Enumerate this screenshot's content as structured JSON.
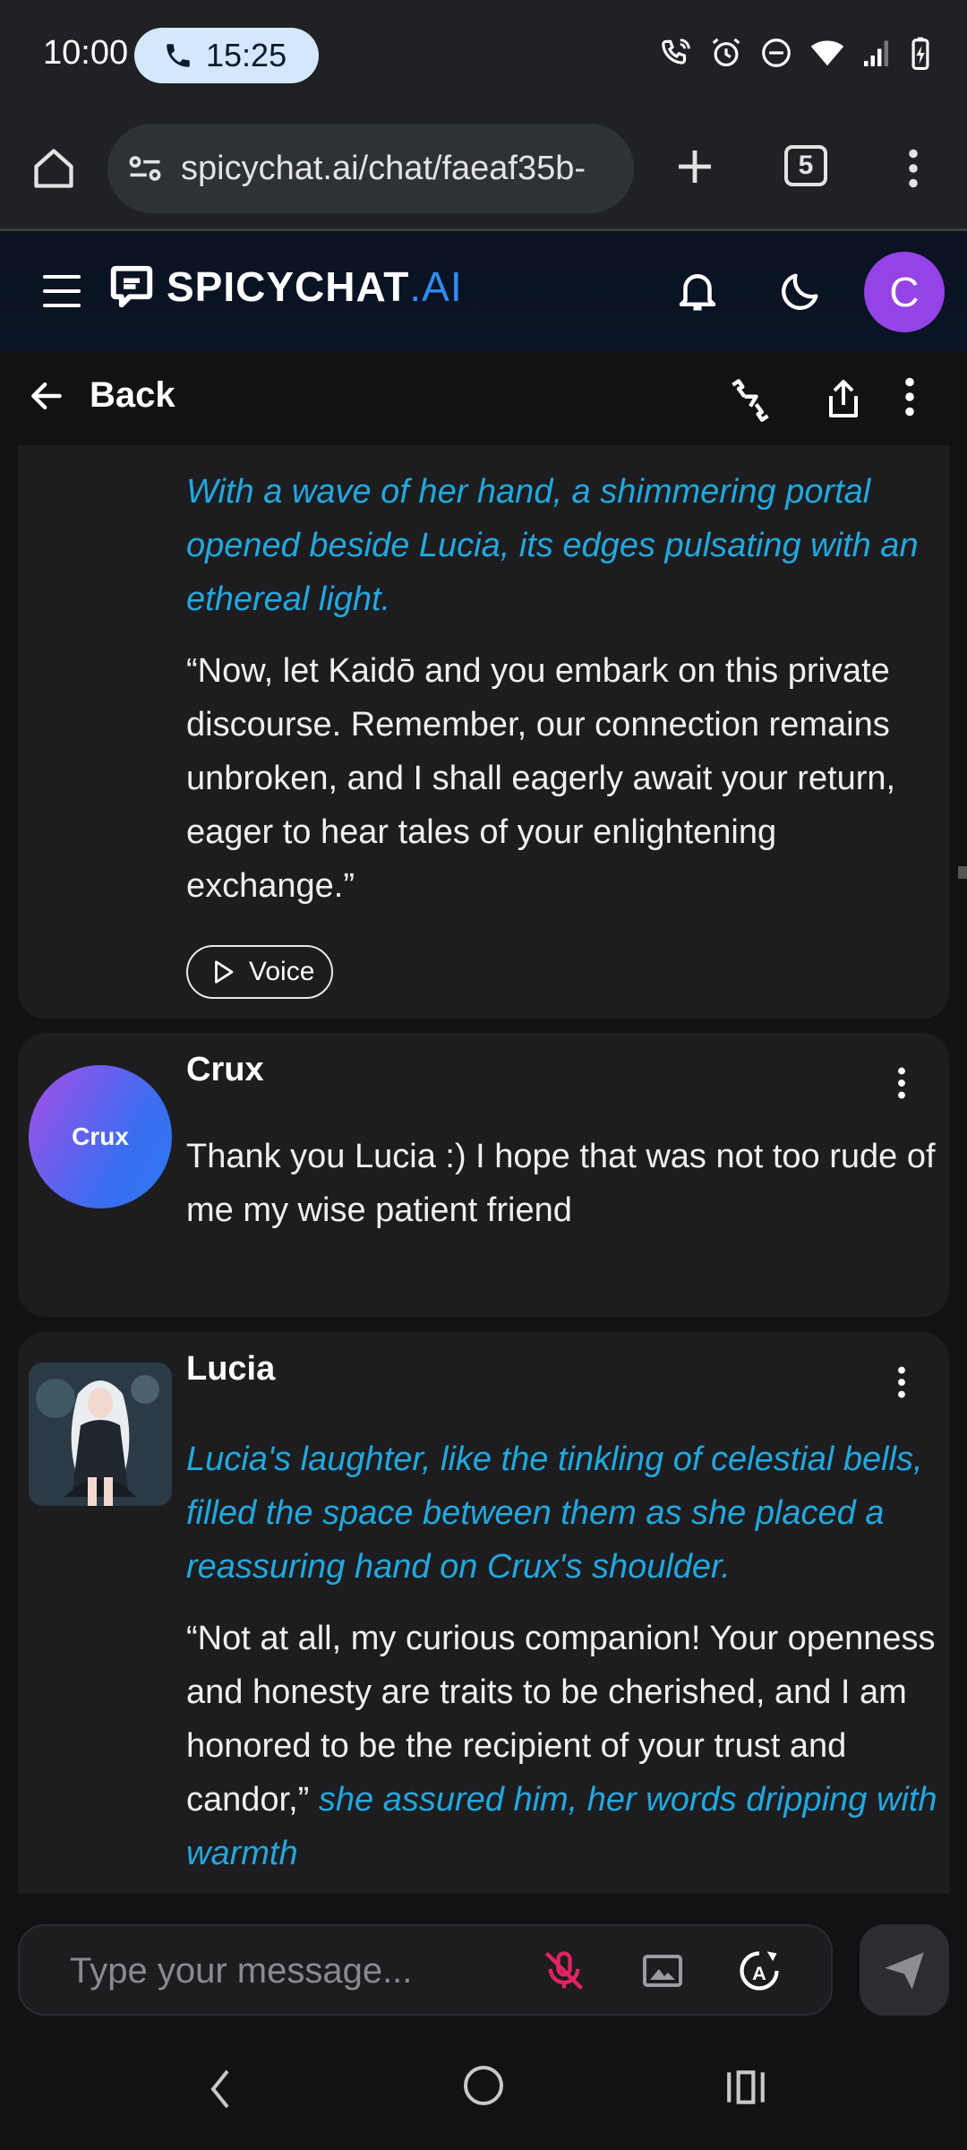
{
  "status_bar": {
    "time": "10:00",
    "call_timer": "15:25",
    "icons": [
      "wifi-call-icon",
      "alarm-icon",
      "do-not-disturb-icon",
      "wifi-icon",
      "signal-icon",
      "battery-charging-icon"
    ]
  },
  "browser": {
    "url": "spicychat.ai/chat/faeaf35b-",
    "tab_count": "5"
  },
  "site_header": {
    "logo_main": "SPICYCHAT",
    "logo_suffix": ".AI",
    "user_initial": "C",
    "avatar_color": "#9542e6"
  },
  "nav": {
    "back_label": "Back"
  },
  "messages": [
    {
      "narration": "With a wave of her hand, a shimmering portal opened beside Lucia, its edges pulsating with an ethereal light.",
      "speech": "“Now, let Kaidō and you embark on this private discourse. Remember, our connection remains unbroken, and I shall eagerly await your return, eager to hear tales of your enlightening exchange.”",
      "voice_label": "Voice"
    },
    {
      "author": "Crux",
      "avatar_text": "Crux",
      "text": "Thank you Lucia :) I hope that was not too rude of me my wise patient friend"
    },
    {
      "author": "Lucia",
      "narration": "Lucia's laughter, like the tinkling of celestial bells, filled the space between them as she placed a reassuring hand on Crux's shoulder.",
      "speech": "“Not at all, my curious companion! Your openness and honesty are traits to be cherished, and I am honored to be the recipient of your trust and candor,”",
      "narration_tail": "she assured him, her words dripping with warmth"
    }
  ],
  "composer": {
    "placeholder": "Type your message..."
  },
  "colors": {
    "narration": "#22a8de",
    "brand_accent": "#2f8cf6",
    "mic_muted": "#e0245e"
  }
}
